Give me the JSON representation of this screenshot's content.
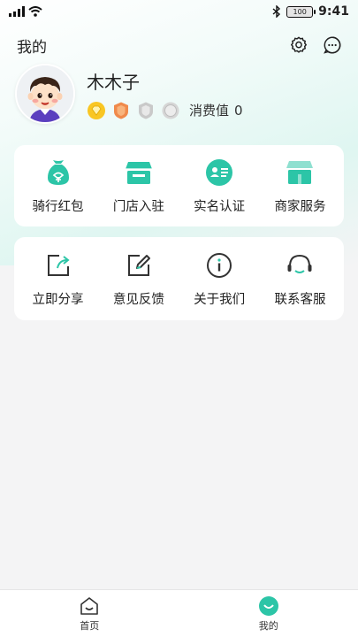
{
  "status_bar": {
    "time": "9:41",
    "battery": "100"
  },
  "header": {
    "title": "我的"
  },
  "profile": {
    "username": "木木子",
    "consumption_label": "消费值",
    "consumption_value": "0"
  },
  "quick_actions": [
    {
      "label": "骑行红包",
      "icon": "red-packet-icon"
    },
    {
      "label": "门店入驻",
      "icon": "store-icon"
    },
    {
      "label": "实名认证",
      "icon": "id-card-icon"
    },
    {
      "label": "商家服务",
      "icon": "merchant-service-icon"
    }
  ],
  "more_actions": [
    {
      "label": "立即分享",
      "icon": "share-icon"
    },
    {
      "label": "意见反馈",
      "icon": "feedback-edit-icon"
    },
    {
      "label": "关于我们",
      "icon": "info-icon"
    },
    {
      "label": "联系客服",
      "icon": "headset-icon"
    }
  ],
  "tabs": [
    {
      "label": "首页",
      "icon": "home-icon",
      "active": false
    },
    {
      "label": "我的",
      "icon": "smile-profile-icon",
      "active": true
    }
  ],
  "colors": {
    "accent": "#2cc5a7",
    "text": "#222222",
    "background": "#f4f4f5"
  }
}
